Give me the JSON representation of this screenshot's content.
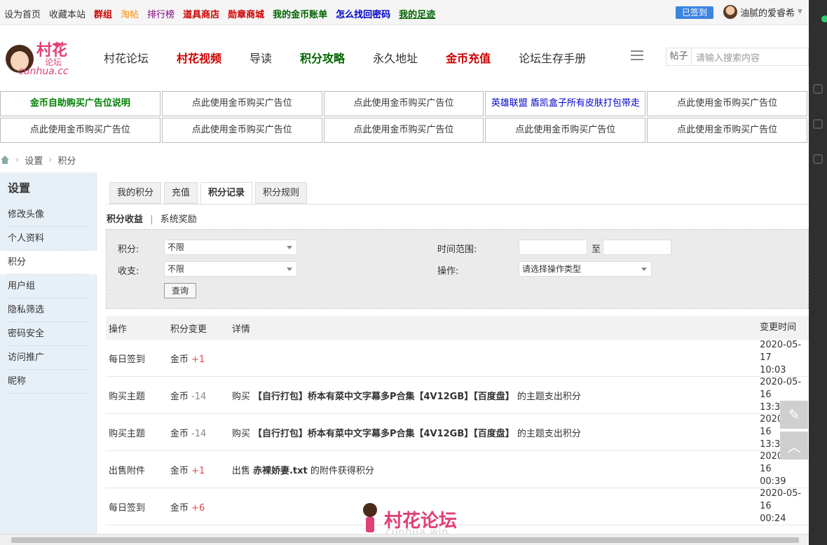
{
  "topbar": {
    "links": [
      {
        "label": "设为首页",
        "color": "#333333"
      },
      {
        "label": "收藏本站",
        "color": "#333333"
      },
      {
        "label": "群组",
        "color": "#cc0000",
        "bold": true
      },
      {
        "label": "淘帖",
        "color": "#ff8c00"
      },
      {
        "label": "排行榜",
        "color": "#800080"
      },
      {
        "label": "道具商店",
        "color": "#cc0000",
        "bold": true
      },
      {
        "label": "勋章商城",
        "color": "#cc0000",
        "bold": true
      },
      {
        "label": "我的金币账单",
        "color": "#006400",
        "bold": true
      },
      {
        "label": "怎么找回密码",
        "color": "#0000cc",
        "bold": true
      },
      {
        "label": "我的足迹",
        "color": "#006400",
        "bold": true,
        "underline": true
      }
    ],
    "signed_label": "已签到",
    "username": "油腻的爱睿希"
  },
  "logo": {
    "title": "村花",
    "sub": "论坛",
    "domain": "cunhua.cc",
    "badge": "3"
  },
  "nav": [
    {
      "label": "村花论坛",
      "color": "#333333"
    },
    {
      "label": "村花视频",
      "color": "#cc0000",
      "bold": true
    },
    {
      "label": "导读",
      "color": "#333333"
    },
    {
      "label": "积分攻略",
      "color": "#006400",
      "bold": true
    },
    {
      "label": "永久地址",
      "color": "#333333"
    },
    {
      "label": "金币充值",
      "color": "#cc0000",
      "bold": true
    },
    {
      "label": "论坛生存手册",
      "color": "#333333"
    }
  ],
  "search": {
    "scope": "帖子",
    "placeholder": "请输入搜索内容"
  },
  "ads": [
    [
      {
        "label": "金币自助购买广告位说明",
        "color": "#008000",
        "bold": true
      },
      {
        "label": "点此使用金币购买广告位",
        "color": "#333333"
      },
      {
        "label": "点此使用金币购买广告位",
        "color": "#333333"
      },
      {
        "label": "英雄联盟 盾凯盒子所有皮肤打包带走",
        "color": "#0000cc"
      },
      {
        "label": "点此使用金币购买广告位",
        "color": "#333333"
      }
    ],
    [
      {
        "label": "点此使用金币购买广告位",
        "color": "#333333"
      },
      {
        "label": "点此使用金币购买广告位",
        "color": "#333333"
      },
      {
        "label": "点此使用金币购买广告位",
        "color": "#333333"
      },
      {
        "label": "点此使用金币购买广告位",
        "color": "#333333"
      },
      {
        "label": "点此使用金币购买广告位",
        "color": "#333333"
      }
    ]
  ],
  "breadcrumb": {
    "items": [
      "设置",
      "积分"
    ],
    "sep": "›"
  },
  "sidebar": {
    "title": "设置",
    "items": [
      "修改头像",
      "个人资料",
      "积分",
      "用户组",
      "隐私筛选",
      "密码安全",
      "访问推广",
      "昵称"
    ],
    "active": 2
  },
  "tabs": {
    "items": [
      "我的积分",
      "充值",
      "积分记录",
      "积分规则"
    ],
    "active": 2
  },
  "subtabs": {
    "active": "积分收益",
    "sep": "|",
    "other": "系统奖励"
  },
  "filter": {
    "credit_label": "积分:",
    "credit_value": "不限",
    "io_label": "收支:",
    "io_value": "不限",
    "time_label": "时间范围:",
    "time_to": "至",
    "op_label": "操作:",
    "op_value": "请选择操作类型",
    "query_button": "查询"
  },
  "table": {
    "headers": [
      "操作",
      "积分变更",
      "详情",
      "变更时间"
    ],
    "rows": [
      {
        "op": "每日签到",
        "unit": "金币",
        "delta": "+1",
        "sign": "pos",
        "pre": "",
        "bold": "",
        "post": "",
        "date": "2020-05-17",
        "time": "10:03"
      },
      {
        "op": "购买主题",
        "unit": "金币",
        "delta": "-14",
        "sign": "neg",
        "pre": "购买 ",
        "bold": "【自行打包】桥本有菜中文字幕多P合集【4V12GB】【百度盘】",
        "post": " 的主题支出积分",
        "date": "2020-05-16",
        "time": "13:37"
      },
      {
        "op": "购买主题",
        "unit": "金币",
        "delta": "-14",
        "sign": "neg",
        "pre": "购买 ",
        "bold": "【自行打包】桥本有菜中文字幕多P合集【4V12GB】【百度盘】",
        "post": " 的主题支出积分",
        "date": "2020-05-16",
        "time": "13:35"
      },
      {
        "op": "出售附件",
        "unit": "金币",
        "delta": "+1",
        "sign": "pos",
        "pre": "出售 ",
        "bold": "赤裸娇妻.txt",
        "post": " 的附件获得积分",
        "date": "2020-05-16",
        "time": "00:39"
      },
      {
        "op": "每日签到",
        "unit": "金币",
        "delta": "+6",
        "sign": "pos",
        "pre": "",
        "bold": "",
        "post": "",
        "date": "2020-05-16",
        "time": "00:24"
      }
    ]
  },
  "watermark": {
    "text": "村花论坛",
    "sub": "cunhua.win"
  },
  "float_buttons": [
    {
      "icon": "edit-icon"
    },
    {
      "icon": "back-to-top-icon"
    }
  ]
}
